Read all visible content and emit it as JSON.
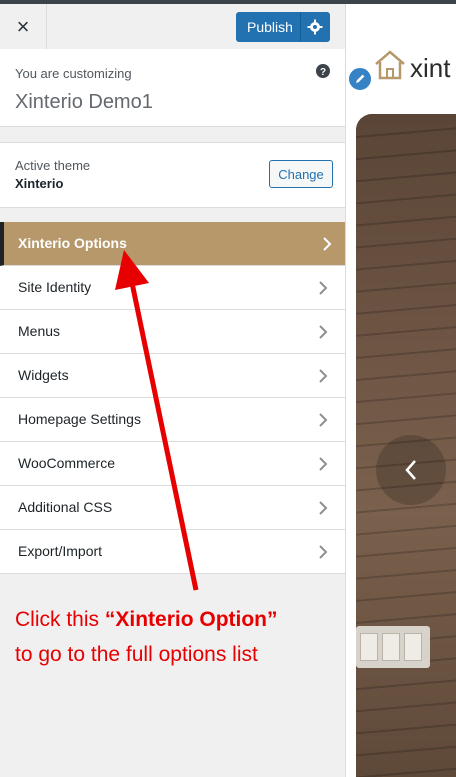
{
  "header": {
    "close_label": "×",
    "publish_label": "Publish"
  },
  "info": {
    "customizing_label": "You are customizing",
    "site_name": "Xinterio Demo1"
  },
  "theme": {
    "active_label": "Active theme",
    "theme_name": "Xinterio",
    "change_label": "Change"
  },
  "menu": {
    "items": [
      {
        "label": "Xinterio Options",
        "active": true
      },
      {
        "label": "Site Identity"
      },
      {
        "label": "Menus"
      },
      {
        "label": "Widgets"
      },
      {
        "label": "Homepage Settings"
      },
      {
        "label": "WooCommerce"
      },
      {
        "label": "Additional CSS"
      },
      {
        "label": "Export/Import"
      }
    ]
  },
  "annotation": {
    "line1_pre": "Click this ",
    "line1_em": "“Xinterio Option”",
    "line2": "to go to the full options list"
  },
  "preview": {
    "brand_text": "xint"
  },
  "colors": {
    "accent": "#b6986b",
    "publish": "#2271b1",
    "annotation": "#e60000"
  }
}
